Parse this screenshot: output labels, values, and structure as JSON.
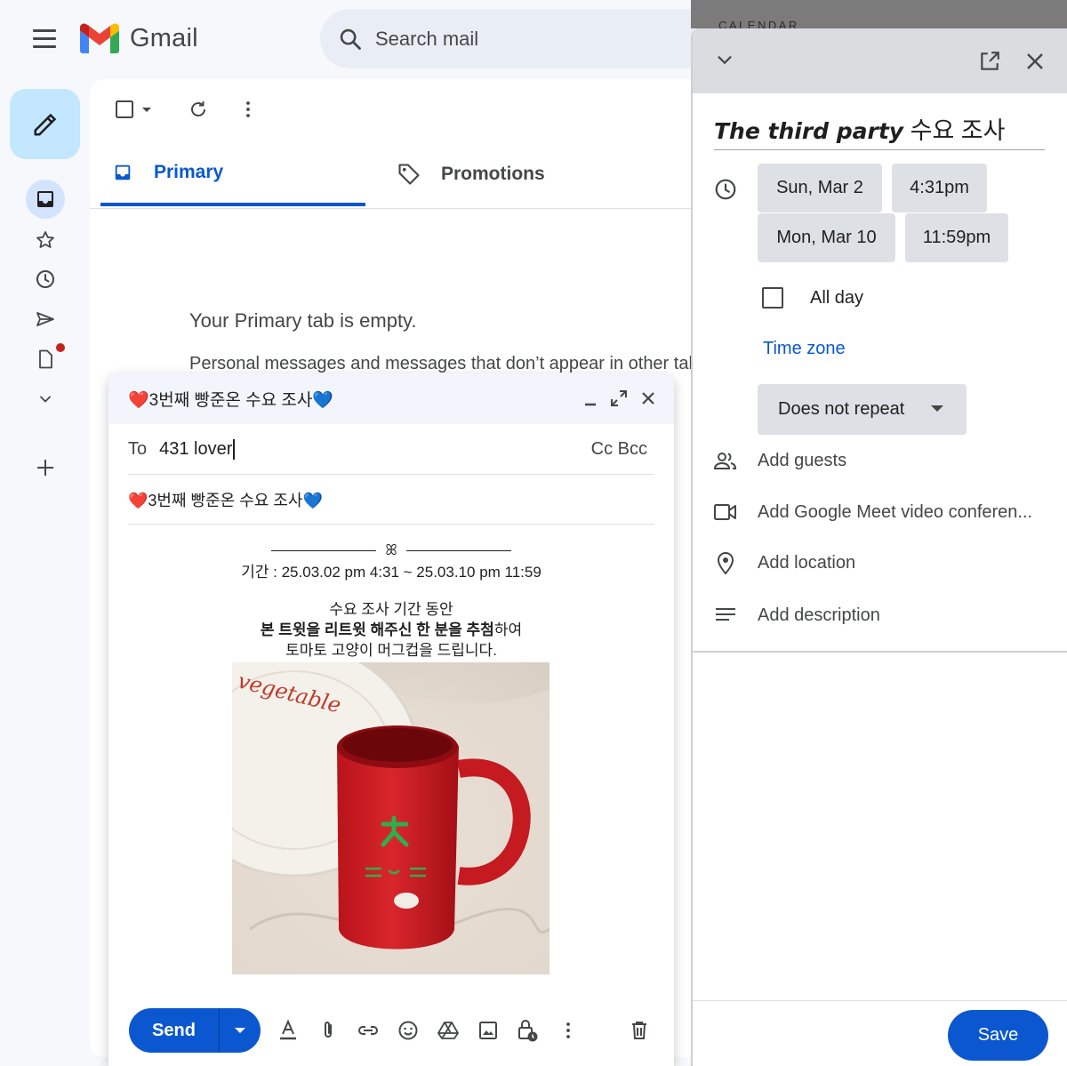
{
  "app": {
    "name": "Gmail"
  },
  "search": {
    "placeholder": "Search mail"
  },
  "tabs": [
    {
      "label": "Primary",
      "active": true
    },
    {
      "label": "Promotions",
      "active": false
    }
  ],
  "empty_state": {
    "title": "Your Primary tab is empty.",
    "subtitle": "Personal messages and messages that don’t appear in other tal"
  },
  "compose": {
    "window_title": "❤️3번째 빵준온 수요 조사💙",
    "to_label": "To",
    "to_value": "431 lover",
    "cc_bcc": "Cc Bcc",
    "subject": "❤️3번째 빵준온 수요 조사💙",
    "body": {
      "ornament": "ꕤ",
      "period": "기간 : 25.03.02 pm 4:31 ~ 25.03.10 pm 11:59",
      "line1": "수요 조사 기간 동안",
      "line2_bold": "본 트윗을 리트윗 해주신 한 분을 추첨",
      "line2_rest": "하여",
      "line3": "토마토 고양이 머그컵을 드립니다.",
      "image_text": "vegetable"
    },
    "send_label": "Send"
  },
  "calendar": {
    "strip_label": "CALENDAR",
    "title_italic": "The third party",
    "title_rest": " 수요 조사",
    "start_date": "Sun, Mar 2",
    "start_time": "4:31pm",
    "end_date": "Mon, Mar 10",
    "end_time": "11:59pm",
    "all_day_label": "All day",
    "all_day_checked": false,
    "time_zone": "Time zone",
    "repeat": "Does not repeat",
    "add_guests": "Add guests",
    "add_meet": "Add Google Meet video conferen...",
    "add_location": "Add location",
    "add_description": "Add description",
    "save_label": "Save"
  },
  "colors": {
    "accent_blue": "#0b57d0",
    "compose_fab": "#c2e7ff",
    "draft_dot": "#c5221f",
    "mug_red": "#cc1f24"
  }
}
